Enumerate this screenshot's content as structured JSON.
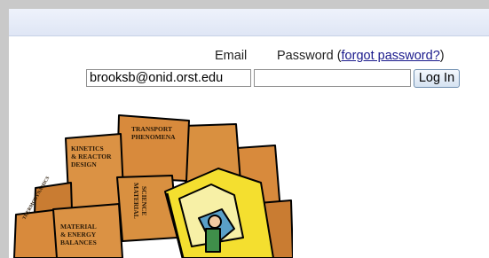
{
  "login": {
    "email_label": "Email",
    "password_label": "Password (",
    "forgot_link": "forgot password?",
    "password_label_end": ")",
    "email_value": "brooksb@onid.orst.edu",
    "password_value": "",
    "login_button": "Log In"
  },
  "illustration": {
    "box_labels": [
      "TRANSPORT",
      "PHENOMENA",
      "KINETICS",
      "& REACTOR",
      "DESIGN",
      "MATERIAL",
      "& ENERGY",
      "BALANCES",
      "MATERIAL",
      "SCIENCE",
      "THERMODYNAMICS"
    ]
  },
  "colors": {
    "box": "#d88a3c",
    "box_dark": "#b96f27",
    "forklift": "#f4df2f",
    "accent_link": "#1a1a8c"
  }
}
